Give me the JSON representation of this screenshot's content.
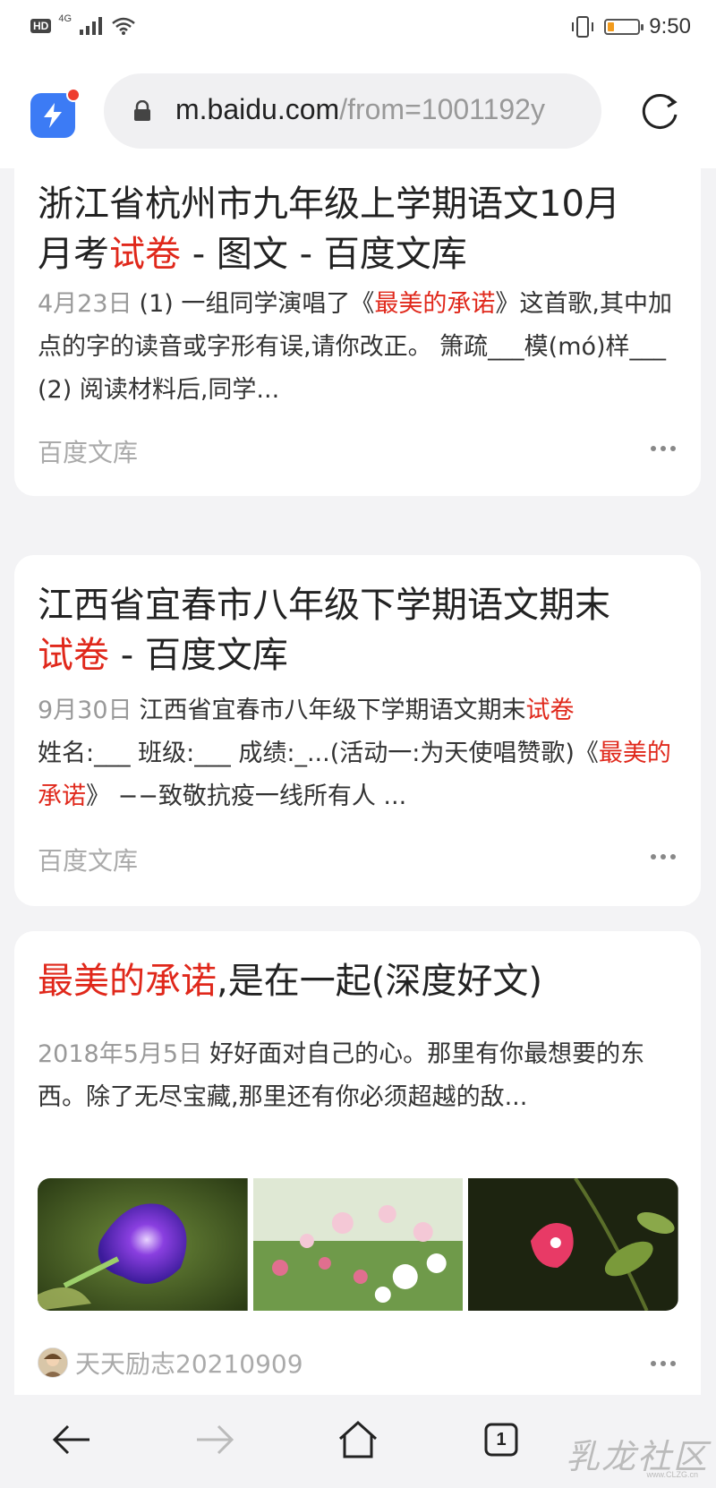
{
  "status_bar": {
    "hd": "HD",
    "network": "4G",
    "time": "9:50",
    "battery_level": 0.2,
    "battery_color": "#f29b1d"
  },
  "address_bar": {
    "url_domain": "m.baidu.com",
    "url_rest": "/from=1001192y",
    "app_icon": "lightning-bolt-icon",
    "lock_icon": "lock-icon",
    "reload_icon": "reload-icon"
  },
  "results": [
    {
      "title_parts": [
        "浙江省杭州市九年级上学期语文10月",
        "月考",
        "试卷",
        " - 图文 - 百度文库"
      ],
      "date": "4月23日",
      "abstract_pre": "(1) 一组同学演唱了《",
      "abstract_hl": "最美的承诺",
      "abstract_post": "》这首歌,其中加点的字的读音或字形有误,请你改正。 箫疏___模(mó)样___ (2) 阅读材料后,同学...",
      "source": "百度文库"
    },
    {
      "title_parts": [
        "江西省宜春市八年级下学期语文期末",
        "试卷",
        " - 百度文库"
      ],
      "date": "9月30日",
      "abstract_pre": "江西省宜春市八年级下学期语文期末",
      "abstract_hl": "试卷",
      "abstract_mid": "姓名:___ 班级:___ 成绩:_...(活动一:为天使唱赞歌)《",
      "abstract_hl2": "最美的承诺",
      "abstract_post": "》 −−致敬抗疫一线所有人 ...",
      "source": "百度文库"
    },
    {
      "title_hl": "最美的承诺",
      "title_rest": ",是在一起(深度好文)",
      "date": "2018年5月5日",
      "abstract": "好好面对自己的心。那里有你最想要的东西。除了无尽宝藏,那里还有你必须超越的敌...",
      "images": [
        "purple-morning-glory-photo",
        "pink-cosmos-field-photo",
        "pink-morning-glory-photo"
      ],
      "author": "天天励志20210909"
    }
  ],
  "bottom_nav": {
    "back_icon": "back-arrow-icon",
    "forward_icon": "forward-arrow-icon",
    "home_icon": "home-icon",
    "tabs_count": "1",
    "watermark": "乳龙社区",
    "watermark_url": "www.CLZG.cn"
  },
  "colors": {
    "highlight": "#e0281b",
    "accent": "#3c7bf5"
  }
}
